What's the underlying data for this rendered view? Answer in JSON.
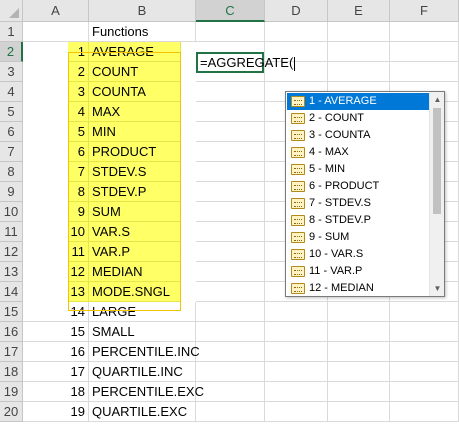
{
  "columns": [
    "A",
    "B",
    "C",
    "D",
    "E",
    "F"
  ],
  "selected_column": "C",
  "selected_row": "2",
  "rows": [
    {
      "row": "1",
      "a": "",
      "b": "Functions",
      "yellow": false
    },
    {
      "row": "2",
      "a": "1",
      "b": "AVERAGE",
      "yellow": true
    },
    {
      "row": "3",
      "a": "2",
      "b": "COUNT",
      "yellow": true
    },
    {
      "row": "4",
      "a": "3",
      "b": "COUNTA",
      "yellow": true
    },
    {
      "row": "5",
      "a": "4",
      "b": "MAX",
      "yellow": true
    },
    {
      "row": "6",
      "a": "5",
      "b": "MIN",
      "yellow": true
    },
    {
      "row": "7",
      "a": "6",
      "b": "PRODUCT",
      "yellow": true
    },
    {
      "row": "8",
      "a": "7",
      "b": "STDEV.S",
      "yellow": true
    },
    {
      "row": "9",
      "a": "8",
      "b": "STDEV.P",
      "yellow": true
    },
    {
      "row": "10",
      "a": "9",
      "b": "SUM",
      "yellow": true
    },
    {
      "row": "11",
      "a": "10",
      "b": "VAR.S",
      "yellow": true
    },
    {
      "row": "12",
      "a": "11",
      "b": "VAR.P",
      "yellow": true
    },
    {
      "row": "13",
      "a": "12",
      "b": "MEDIAN",
      "yellow": true
    },
    {
      "row": "14",
      "a": "13",
      "b": "MODE.SNGL",
      "yellow": true
    },
    {
      "row": "15",
      "a": "14",
      "b": "LARGE",
      "yellow": false
    },
    {
      "row": "16",
      "a": "15",
      "b": "SMALL",
      "yellow": false
    },
    {
      "row": "17",
      "a": "16",
      "b": "PERCENTILE.INC",
      "yellow": false
    },
    {
      "row": "18",
      "a": "17",
      "b": "QUARTILE.INC",
      "yellow": false
    },
    {
      "row": "19",
      "a": "18",
      "b": "PERCENTILE.EXC",
      "yellow": false
    },
    {
      "row": "20",
      "a": "19",
      "b": "QUARTILE.EXC",
      "yellow": false
    }
  ],
  "active_cell": {
    "ref": "C2",
    "value": "=AGGREGATE("
  },
  "autocomplete": {
    "icon": "function-icon",
    "selected_index": 0,
    "items": [
      "1 - AVERAGE",
      "2 - COUNT",
      "3 - COUNTA",
      "4 - MAX",
      "5 - MIN",
      "6 - PRODUCT",
      "7 - STDEV.S",
      "8 - STDEV.P",
      "9 - SUM",
      "10 - VAR.S",
      "11 - VAR.P",
      "12 - MEDIAN"
    ],
    "scroll_up_glyph": "▲",
    "scroll_down_glyph": "▼"
  },
  "colors": {
    "highlight_fill": "#ffff66",
    "selection_accent": "#217346",
    "dropdown_selected": "#0078d7"
  }
}
